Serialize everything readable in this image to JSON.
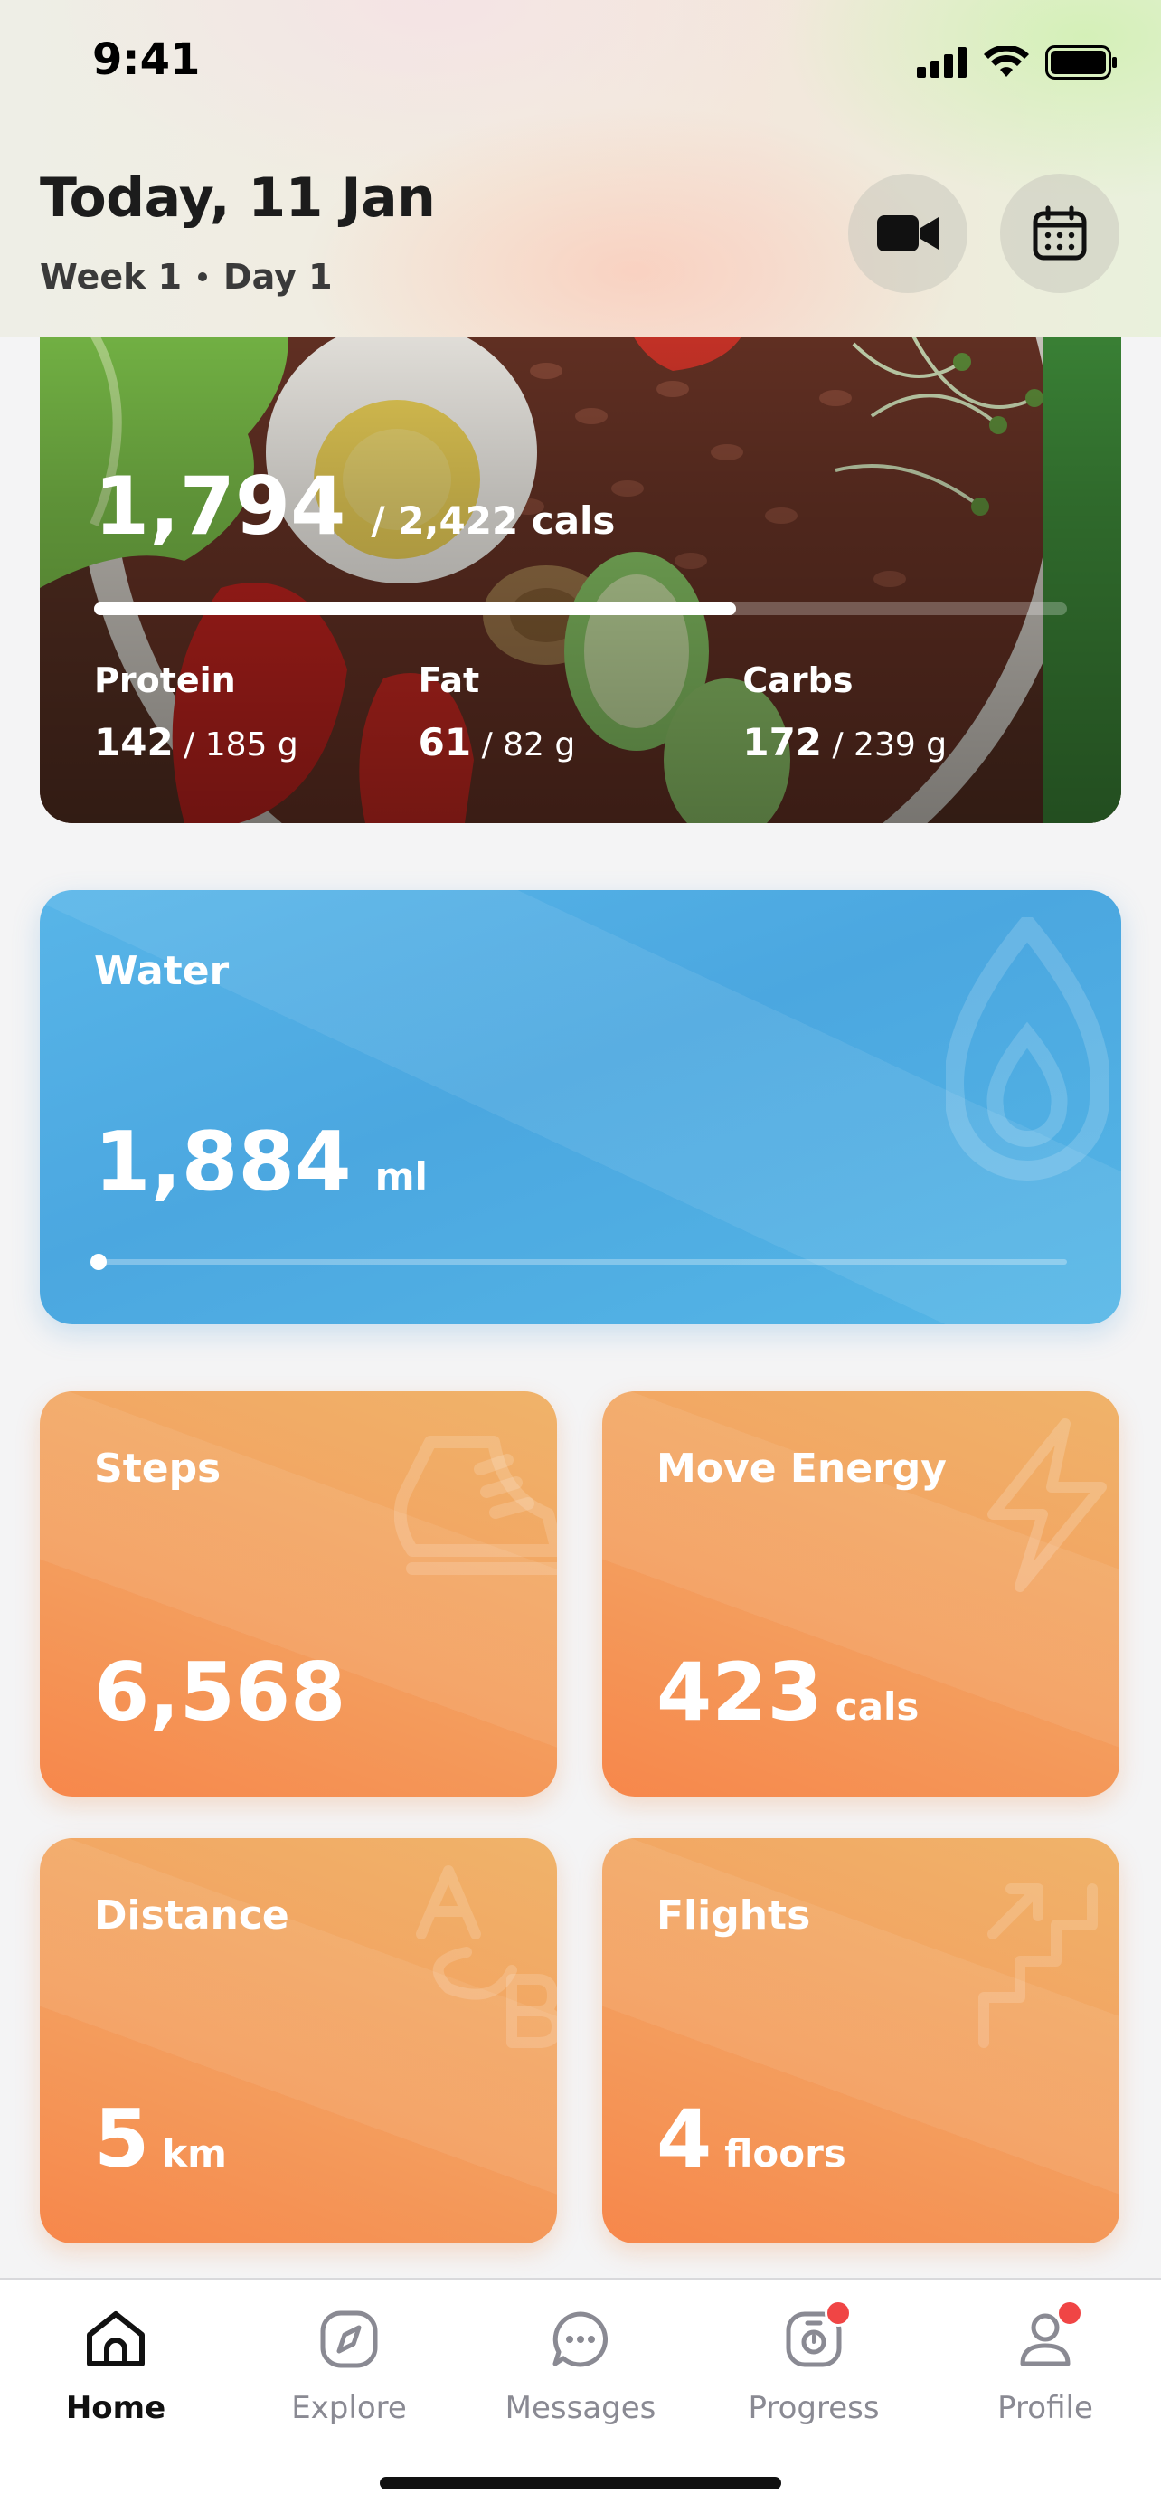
{
  "status_bar": {
    "time": "9:41"
  },
  "header": {
    "title": "Today, 11 Jan",
    "week": "Week 1",
    "day": "Day 1",
    "video_button_icon": "video-camera-icon",
    "calendar_button_icon": "calendar-icon"
  },
  "calories": {
    "consumed": "1,794",
    "goal_text": "/  2,422 cals",
    "progress": 0.66,
    "macros": [
      {
        "name": "Protein",
        "value": "142",
        "goal": "/ 185 g"
      },
      {
        "name": "Fat",
        "value": "61",
        "goal": "/ 82 g"
      },
      {
        "name": "Carbs",
        "value": "172",
        "goal": "/ 239 g"
      }
    ]
  },
  "water": {
    "label": "Water",
    "value": "1,884",
    "unit": "ml",
    "progress": 0.005,
    "color": "#4ba7e0"
  },
  "stats": [
    {
      "label": "Steps",
      "value": "6,568",
      "unit": "",
      "icon": "sneaker-icon"
    },
    {
      "label": "Move Energy",
      "value": "423",
      "unit": "cals",
      "icon": "lightning-icon"
    },
    {
      "label": "Distance",
      "value": "5",
      "unit": "km",
      "icon": "a-to-b-icon"
    },
    {
      "label": "Flights",
      "value": "4",
      "unit": "floors",
      "icon": "stairs-icon"
    }
  ],
  "tabs": [
    {
      "label": "Home",
      "icon": "home-icon",
      "active": true,
      "badge": false
    },
    {
      "label": "Explore",
      "icon": "compass-icon",
      "active": false,
      "badge": false
    },
    {
      "label": "Messages",
      "icon": "chat-icon",
      "active": false,
      "badge": false
    },
    {
      "label": "Progress",
      "icon": "scale-icon",
      "active": false,
      "badge": true
    },
    {
      "label": "Profile",
      "icon": "user-icon",
      "active": false,
      "badge": true
    }
  ],
  "colors": {
    "orange_card": "#f39f5f",
    "badge": "#f04545"
  }
}
